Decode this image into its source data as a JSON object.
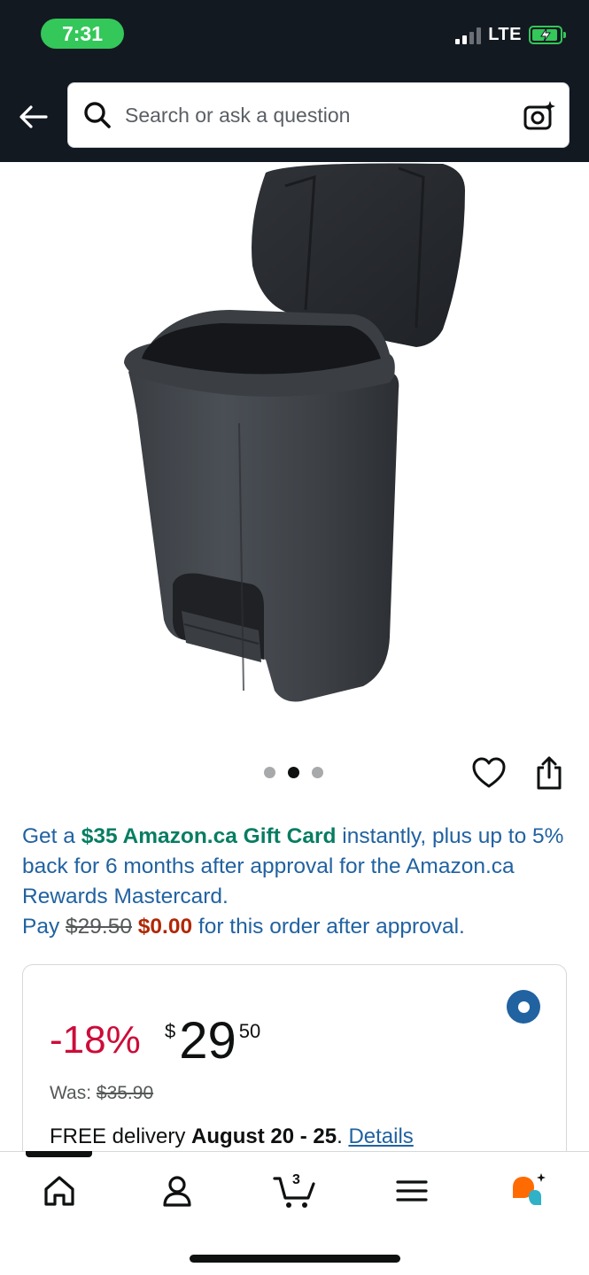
{
  "status_bar": {
    "time": "7:31",
    "network": "LTE"
  },
  "search": {
    "placeholder": "Search or ask a question"
  },
  "gallery": {
    "total_images": 3,
    "active_index": 2
  },
  "promo": {
    "text_1": "Get a ",
    "gift_card": "$35 Amazon.ca Gift Card",
    "text_2": " instantly, plus up to 5% back for 6 months after approval for the Amazon.ca Rewards Mastercard.",
    "pay_label": "Pay ",
    "original_price": "$29.50",
    "new_price": "$0.00",
    "text_3": " for this order after approval."
  },
  "price_card": {
    "discount": "-18%",
    "currency": "$",
    "price_whole": "29",
    "price_fraction": "50",
    "was_label": "Was: ",
    "was_price": "$35.90",
    "delivery_prefix": "FREE delivery ",
    "delivery_dates": "August 20 - 25",
    "delivery_suffix": ". ",
    "details_link": "Details"
  },
  "bottom_nav": {
    "cart_count": "3",
    "items": [
      "home-icon",
      "account-icon",
      "cart-icon",
      "menu-icon",
      "rufus-ai-icon"
    ]
  },
  "colors": {
    "header_bg": "#131921",
    "link_blue": "#2162a1",
    "deal_red": "#cc0c39",
    "promo_green": "#067d62",
    "price_red": "#b12704",
    "status_green": "#34c759"
  }
}
